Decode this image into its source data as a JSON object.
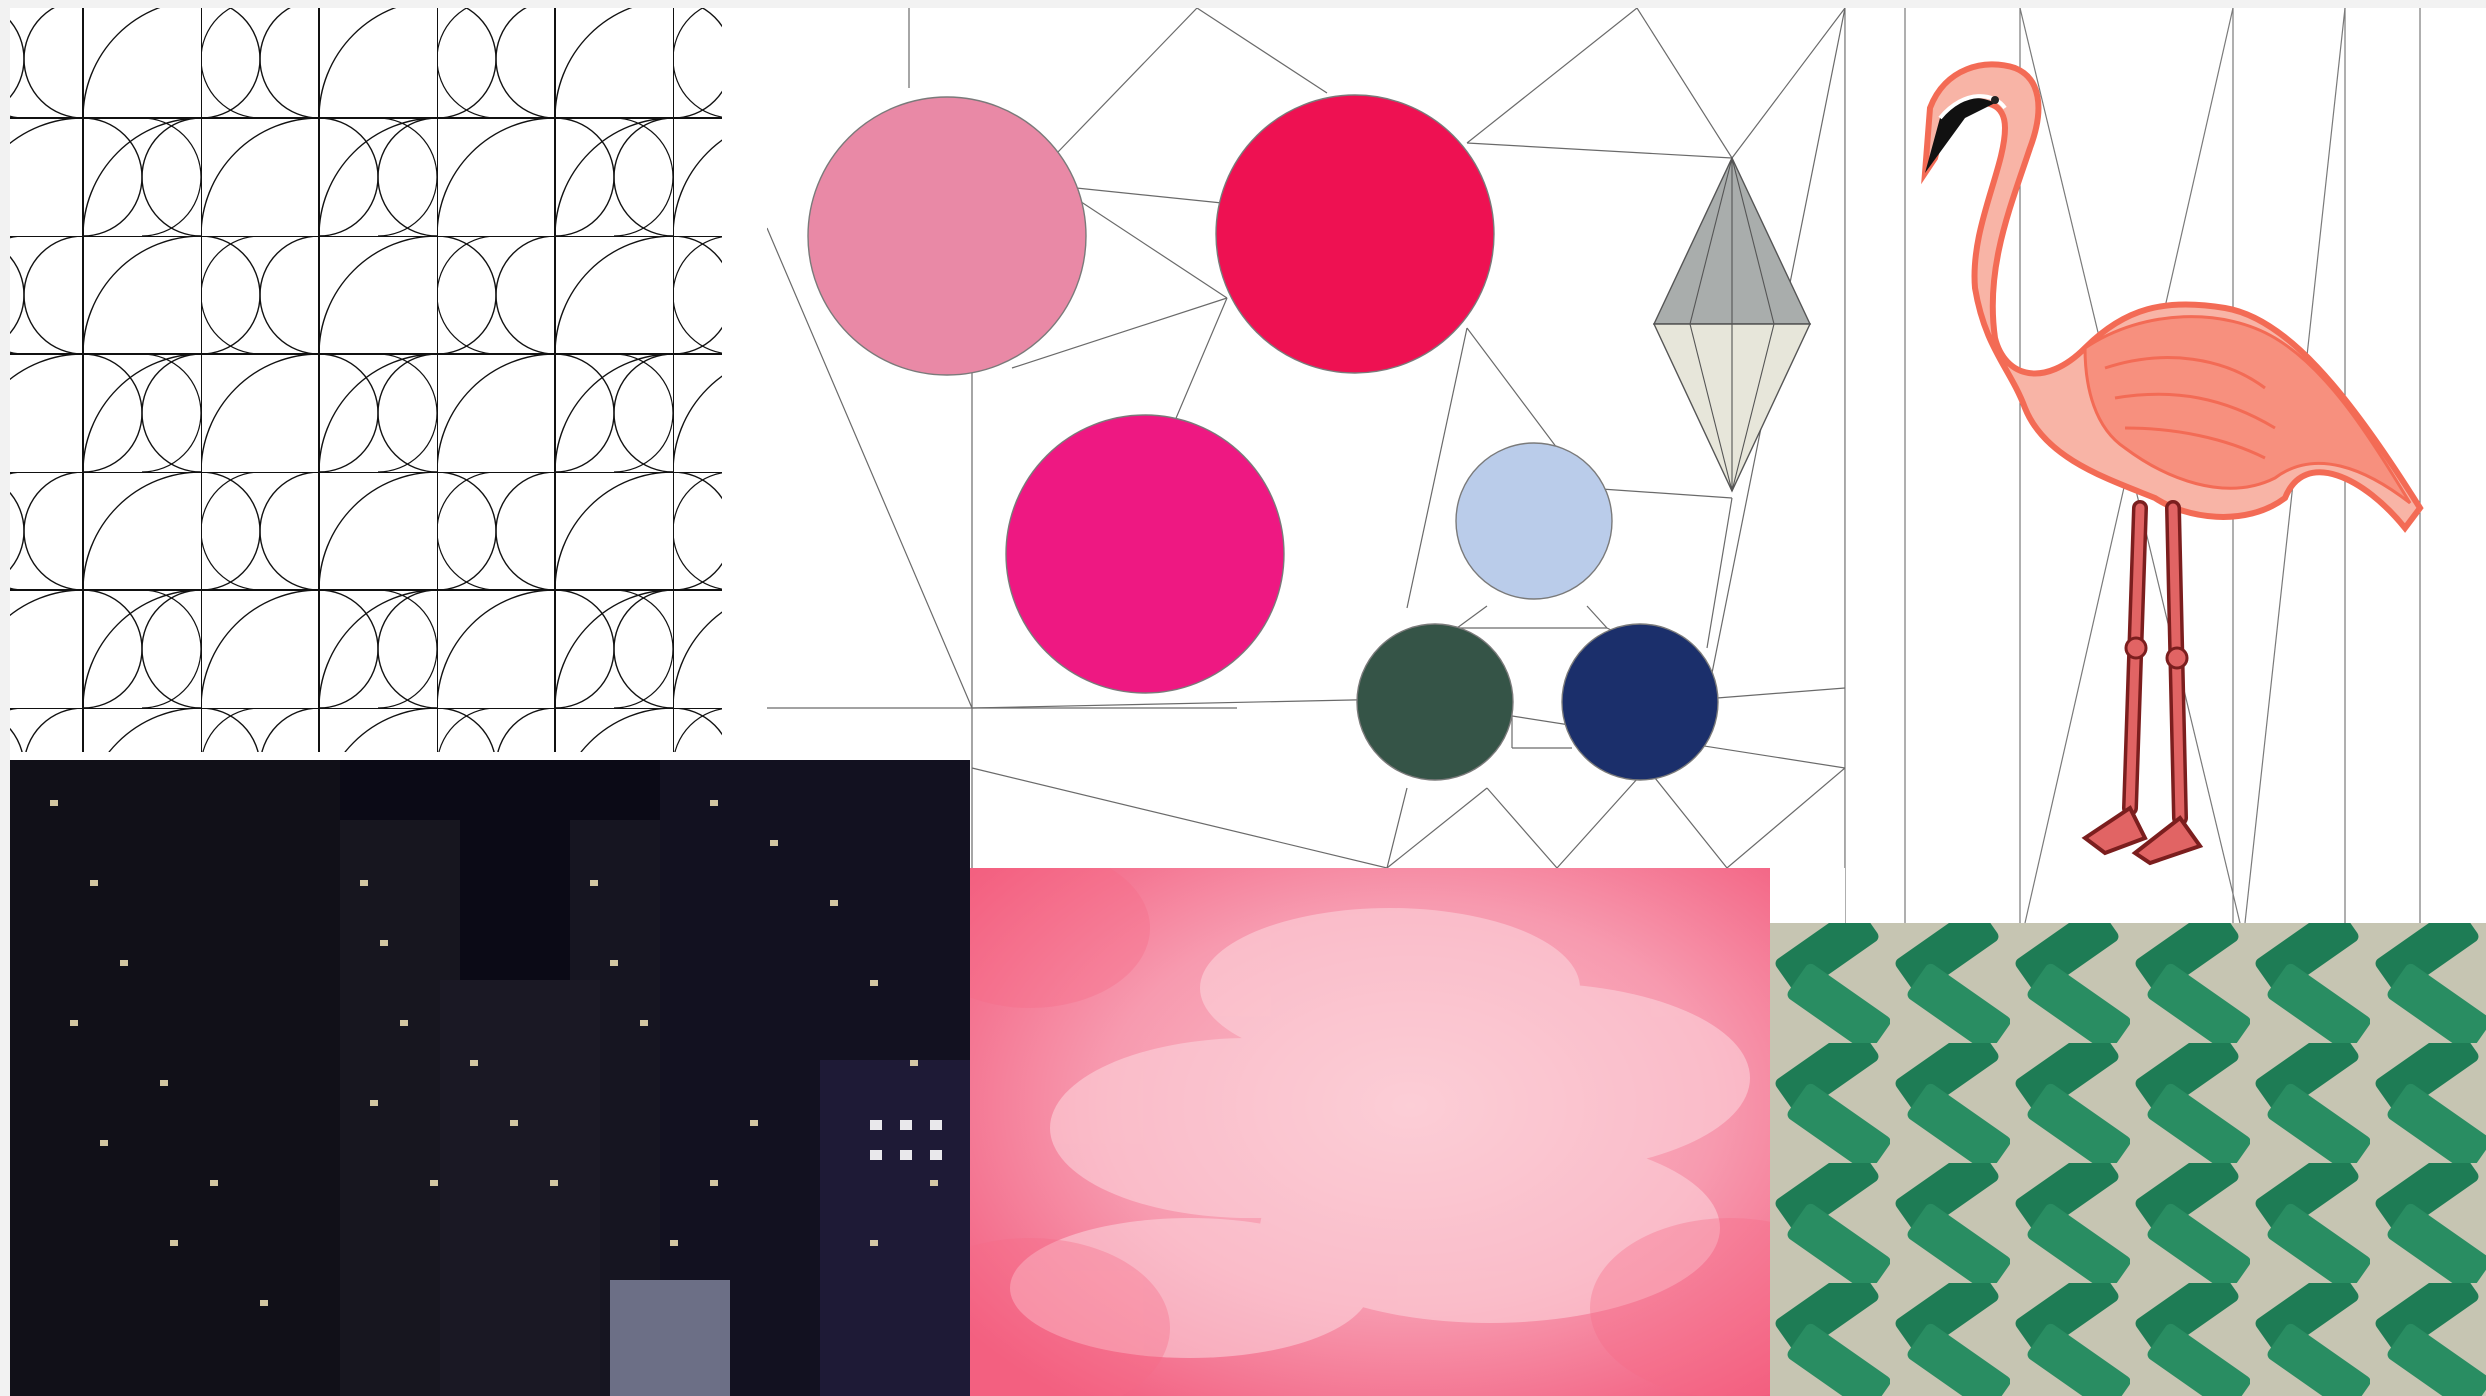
{
  "board": {
    "palette": [
      {
        "name": "light-pink",
        "hex": "#E989A6"
      },
      {
        "name": "crimson",
        "hex": "#EE1152"
      },
      {
        "name": "hot-pink",
        "hex": "#EE1882"
      },
      {
        "name": "pale-blue",
        "hex": "#BACCEA"
      },
      {
        "name": "dark-green",
        "hex": "#355447"
      },
      {
        "name": "navy",
        "hex": "#1B2F6B"
      }
    ],
    "gem_colors": {
      "top": "#A9ADAC",
      "bottom": "#E7E6DA"
    },
    "tiles": [
      {
        "id": "curve-pattern",
        "icon": "line-art-pattern"
      },
      {
        "id": "palette-swatches",
        "icon": "color-swatch"
      },
      {
        "id": "flamingo",
        "icon": "flamingo-illustration"
      },
      {
        "id": "city-night",
        "icon": "city-photo"
      },
      {
        "id": "pink-clouds",
        "icon": "cloud-photo"
      },
      {
        "id": "green-tiles",
        "icon": "herringbone-tile-photo"
      }
    ]
  }
}
